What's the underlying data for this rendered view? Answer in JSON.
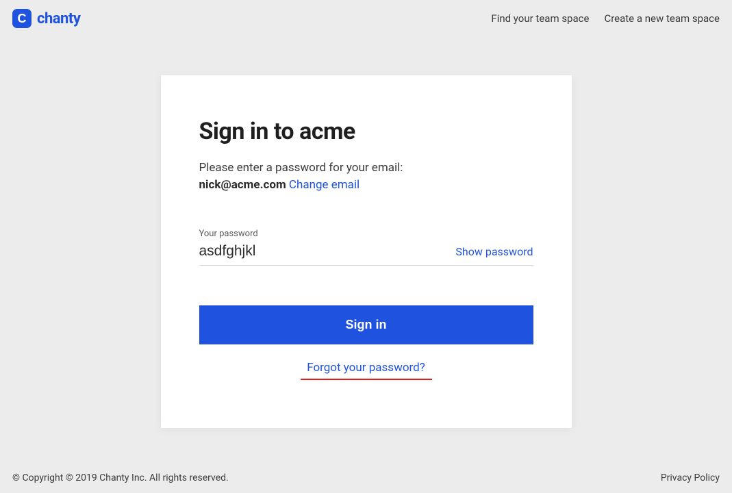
{
  "brand": {
    "mark_letter": "C",
    "name": "chanty"
  },
  "top_nav": {
    "find_team": "Find your team space",
    "create_team": "Create a new team space"
  },
  "card": {
    "title": "Sign in to acme",
    "instruction": "Please enter a password for your email:",
    "email": "nick@acme.com",
    "change_email": "Change email",
    "password_label": "Your password",
    "password_value": "asdfghjkl",
    "show_password": "Show password",
    "signin_button": "Sign in",
    "forgot_link": "Forgot your password?"
  },
  "footer": {
    "copyright": "© Copyright © 2019 Chanty Inc. All rights reserved.",
    "privacy": "Privacy Policy"
  }
}
